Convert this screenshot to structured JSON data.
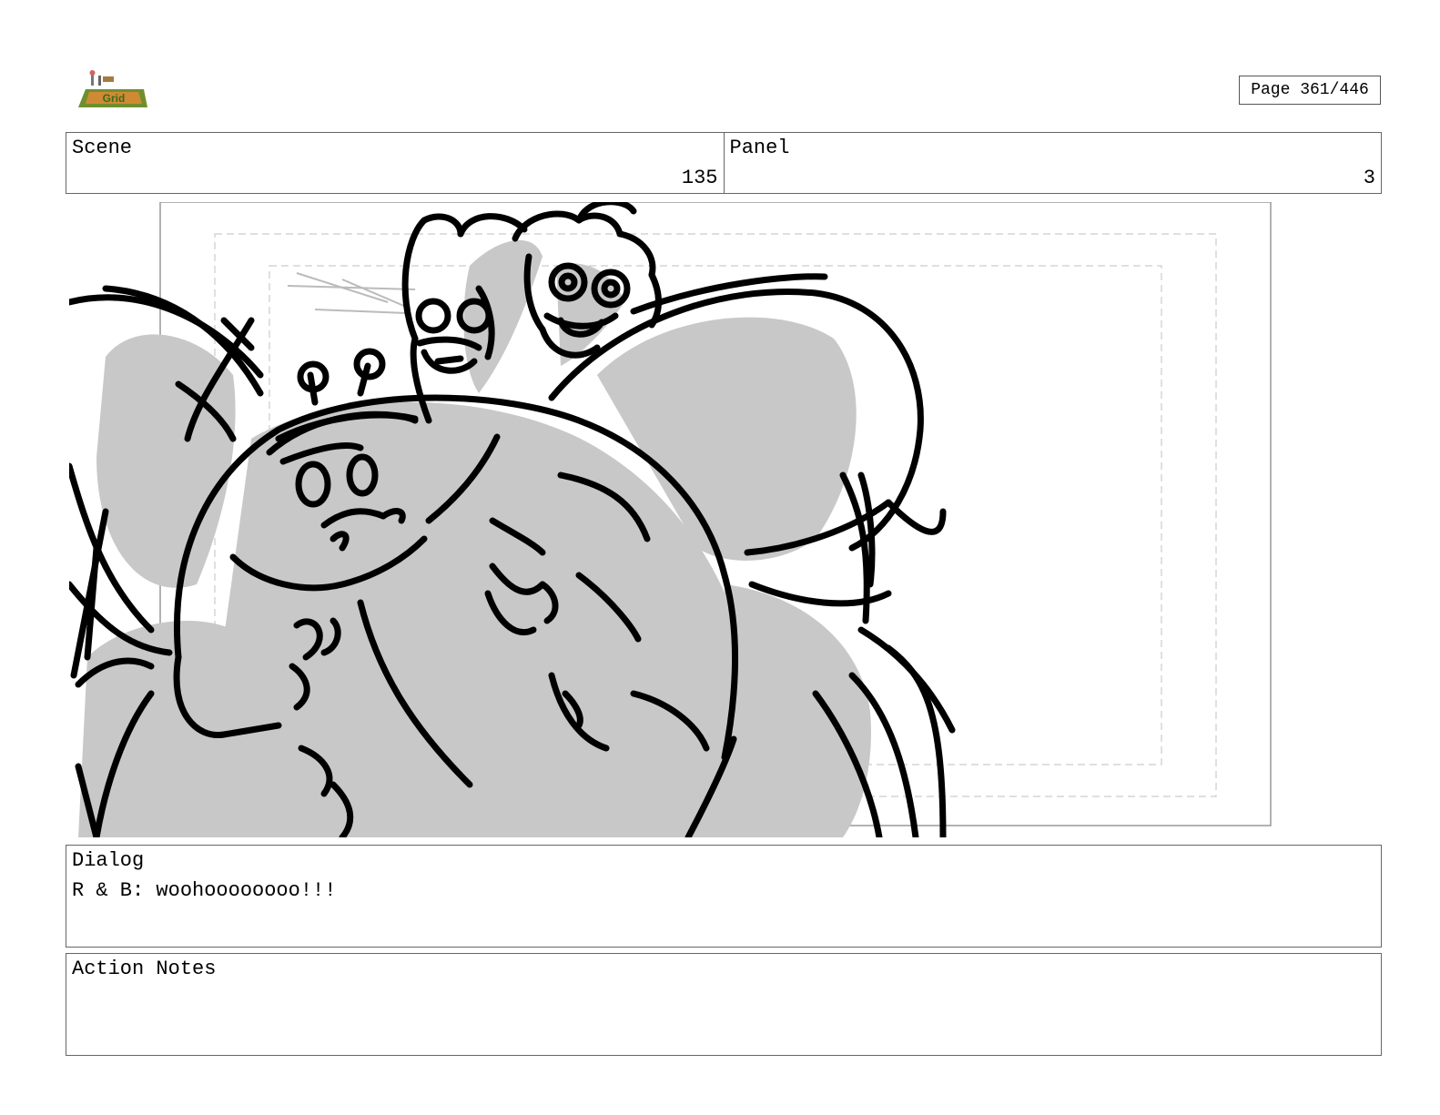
{
  "header": {
    "logo": {
      "icon": "show-logo-icon",
      "text": "Grid"
    },
    "page_label": "Page 361/446"
  },
  "scene": {
    "label": "Scene",
    "value": "135"
  },
  "panel": {
    "label": "Panel",
    "value": "3"
  },
  "drawing": {
    "icon": "storyboard-sketch-image"
  },
  "dialog": {
    "label": "Dialog",
    "text": "R & B: woohoooooooo!!!"
  },
  "action_notes": {
    "label": "Action Notes",
    "text": ""
  }
}
